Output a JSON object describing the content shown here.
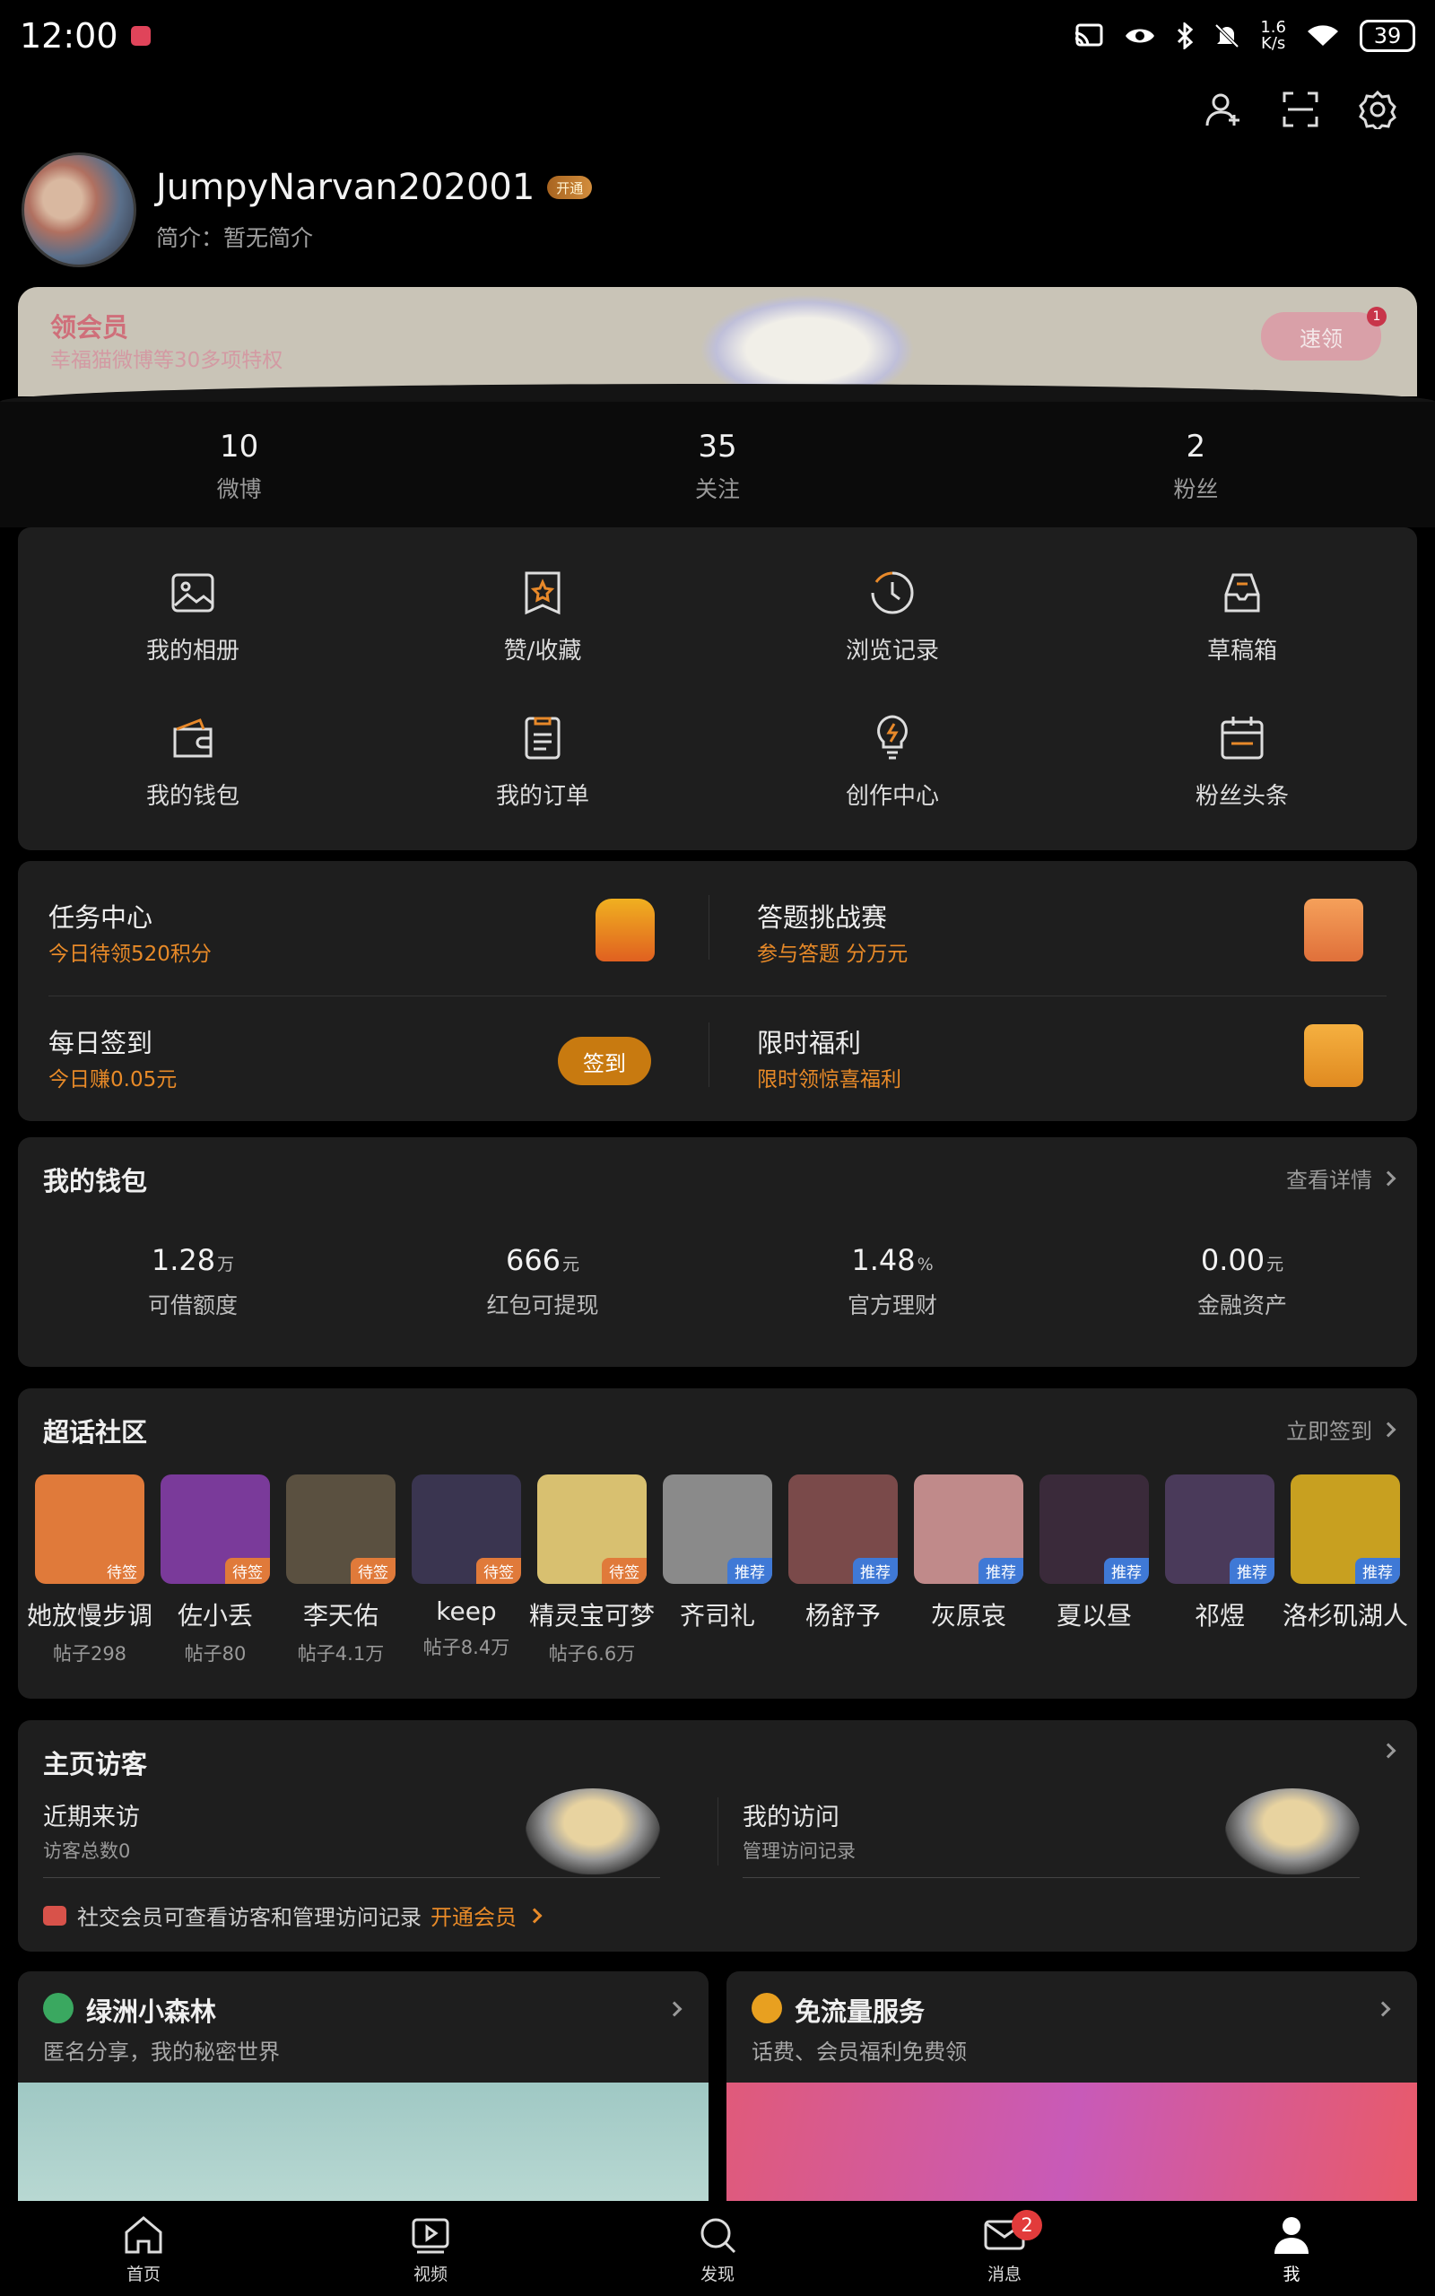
{
  "status_bar": {
    "time": "12:00",
    "net_speed_value": "1.6",
    "net_speed_unit": "K/s",
    "battery": "39"
  },
  "top_icons": [
    "add-friend-icon",
    "scan-icon",
    "settings-icon"
  ],
  "profile": {
    "username": "JumpyNarvan202001",
    "vip_badge": "开通",
    "intro": "简介：暂无简介"
  },
  "vip_banner": {
    "title": "领会员",
    "subtitle": "幸福猫微博等30多项特权",
    "claim": "速领",
    "claim_badge": "1"
  },
  "stats": [
    {
      "value": "10",
      "label": "微博"
    },
    {
      "value": "35",
      "label": "关注"
    },
    {
      "value": "2",
      "label": "粉丝"
    }
  ],
  "grid": [
    {
      "icon": "album-icon",
      "label": "我的相册"
    },
    {
      "icon": "favorites-icon",
      "label": "赞/收藏"
    },
    {
      "icon": "history-icon",
      "label": "浏览记录"
    },
    {
      "icon": "drafts-icon",
      "label": "草稿箱"
    },
    {
      "icon": "wallet-icon",
      "label": "我的钱包"
    },
    {
      "icon": "orders-icon",
      "label": "我的订单"
    },
    {
      "icon": "creator-icon",
      "label": "创作中心"
    },
    {
      "icon": "fans-headline-icon",
      "label": "粉丝头条"
    }
  ],
  "tasks": [
    {
      "title": "任务中心",
      "sub": "今日待领520积分"
    },
    {
      "title": "答题挑战赛",
      "sub": "参与答题 分万元"
    },
    {
      "title": "每日签到",
      "sub": "今日赚0.05元",
      "button": "签到"
    },
    {
      "title": "限时福利",
      "sub": "限时领惊喜福利"
    }
  ],
  "wallet": {
    "title": "我的钱包",
    "link": "查看详情",
    "items": [
      {
        "value": "1.28",
        "unit": "万",
        "label": "可借额度"
      },
      {
        "value": "666",
        "unit": "元",
        "label": "红包可提现"
      },
      {
        "value": "1.48",
        "unit": "%",
        "label": "官方理财"
      },
      {
        "value": "0.00",
        "unit": "元",
        "label": "金融资产"
      }
    ]
  },
  "super_topics": {
    "title": "超话社区",
    "link": "立即签到",
    "items": [
      {
        "name": "她放慢步调",
        "posts": "帖子298",
        "tag": "待签",
        "color": "#e07a3a"
      },
      {
        "name": "佐小丢",
        "posts": "帖子80",
        "tag": "待签",
        "color": "#7a3a9a"
      },
      {
        "name": "李天佑",
        "posts": "帖子4.1万",
        "tag": "待签",
        "color": "#5a5040"
      },
      {
        "name": "keep",
        "posts": "帖子8.4万",
        "tag": "待签",
        "color": "#3a3550"
      },
      {
        "name": "精灵宝可梦",
        "posts": "帖子6.6万",
        "tag": "待签",
        "color": "#d8c070"
      },
      {
        "name": "齐司礼",
        "posts": "",
        "tag": "推荐",
        "color": "#8a8a8a"
      },
      {
        "name": "杨舒予",
        "posts": "",
        "tag": "推荐",
        "color": "#7a4a4a"
      },
      {
        "name": "灰原哀",
        "posts": "",
        "tag": "推荐",
        "color": "#c08a8a"
      },
      {
        "name": "夏以昼",
        "posts": "",
        "tag": "推荐",
        "color": "#3a2a3a"
      },
      {
        "name": "祁煜",
        "posts": "",
        "tag": "推荐",
        "color": "#4a3a5a"
      },
      {
        "name": "洛杉矶湖人",
        "posts": "",
        "tag": "推荐",
        "color": "#c8a020"
      }
    ]
  },
  "visitors": {
    "title": "主页访客",
    "recent_title": "近期来访",
    "recent_sub": "访客总数0",
    "mine_title": "我的访问",
    "mine_sub": "管理访问记录",
    "note": "社交会员可查看访客和管理访问记录",
    "note_link": "开通会员"
  },
  "promos": [
    {
      "title": "绿洲小森林",
      "sub": "匿名分享，我的秘密世界",
      "accent": "#3aa860"
    },
    {
      "title": "免流量服务",
      "sub": "话费、会员福利免费领",
      "accent": "#e8a020"
    }
  ],
  "tabs": [
    {
      "label": "首页",
      "icon": "home-icon"
    },
    {
      "label": "视频",
      "icon": "video-icon"
    },
    {
      "label": "发现",
      "icon": "discover-icon"
    },
    {
      "label": "消息",
      "icon": "message-icon",
      "badge": "2"
    },
    {
      "label": "我",
      "icon": "me-icon"
    }
  ]
}
